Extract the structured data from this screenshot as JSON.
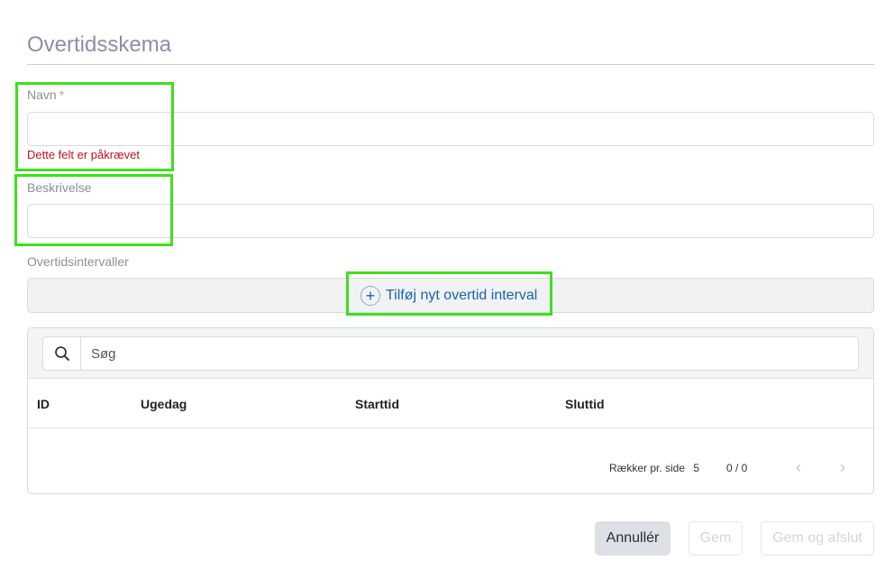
{
  "form": {
    "title": "Overtidsskema",
    "name_label": "Navn",
    "name_required_mark": "*",
    "name_value": "",
    "name_error": "Dette felt er påkrævet",
    "description_label": "Beskrivelse",
    "description_value": "",
    "intervals_label": "Overtidsintervaller",
    "add_interval_label": "Tilføj nyt overtid interval"
  },
  "table": {
    "search_placeholder": "Søg",
    "columns": [
      "ID",
      "Ugedag",
      "Starttid",
      "Sluttid"
    ],
    "rows": [],
    "rows_per_page_label": "Rækker pr. side",
    "rows_per_page_value": "5",
    "page_range": "0 / 0"
  },
  "actions": {
    "cancel_label": "Annullér",
    "save_label": "Gem",
    "save_close_label": "Gem og afslut"
  },
  "colors": {
    "highlight": "#3fe01c",
    "error": "#c40f1e",
    "link": "#1864ab"
  }
}
